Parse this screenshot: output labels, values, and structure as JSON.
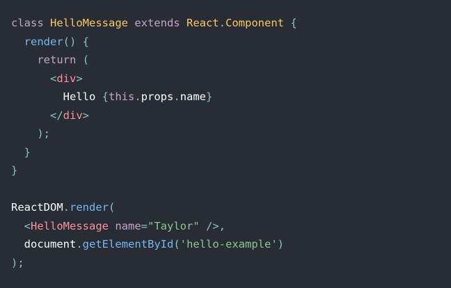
{
  "editor": {
    "language": "jsx",
    "background_color": "#282c34",
    "colors": {
      "keyword": "#c5a5c5",
      "class": "#fac863",
      "tag": "#fc929e",
      "string": "#8dc891",
      "function": "#79b6f2",
      "punctuation": "#88c6be",
      "plain": "#ffffff"
    },
    "lines": [
      [
        {
          "t": "keyword",
          "v": "class "
        },
        {
          "t": "class",
          "v": "HelloMessage"
        },
        {
          "t": "keyword",
          "v": " extends "
        },
        {
          "t": "class",
          "v": "React"
        },
        {
          "t": "punct",
          "v": "."
        },
        {
          "t": "class",
          "v": "Component"
        },
        {
          "t": "punct",
          "v": " {"
        }
      ],
      [
        {
          "t": "plain",
          "v": "  "
        },
        {
          "t": "func",
          "v": "render"
        },
        {
          "t": "punct",
          "v": "() {"
        }
      ],
      [
        {
          "t": "plain",
          "v": "    "
        },
        {
          "t": "keyword",
          "v": "return"
        },
        {
          "t": "punct",
          "v": " ("
        }
      ],
      [
        {
          "t": "plain",
          "v": "      "
        },
        {
          "t": "punct",
          "v": "<"
        },
        {
          "t": "tag",
          "v": "div"
        },
        {
          "t": "punct",
          "v": ">"
        }
      ],
      [
        {
          "t": "plain",
          "v": "        Hello "
        },
        {
          "t": "punct",
          "v": "{"
        },
        {
          "t": "this",
          "v": "this"
        },
        {
          "t": "punct",
          "v": "."
        },
        {
          "t": "prop",
          "v": "props"
        },
        {
          "t": "punct",
          "v": "."
        },
        {
          "t": "prop",
          "v": "name"
        },
        {
          "t": "punct",
          "v": "}"
        }
      ],
      [
        {
          "t": "plain",
          "v": "      "
        },
        {
          "t": "punct",
          "v": "</"
        },
        {
          "t": "tag",
          "v": "div"
        },
        {
          "t": "punct",
          "v": ">"
        }
      ],
      [
        {
          "t": "plain",
          "v": "    "
        },
        {
          "t": "punct",
          "v": ");"
        }
      ],
      [
        {
          "t": "plain",
          "v": "  "
        },
        {
          "t": "punct",
          "v": "}"
        }
      ],
      [
        {
          "t": "punct",
          "v": "}"
        }
      ],
      [],
      [
        {
          "t": "plain",
          "v": "ReactDOM"
        },
        {
          "t": "punct",
          "v": "."
        },
        {
          "t": "func",
          "v": "render"
        },
        {
          "t": "punct",
          "v": "("
        }
      ],
      [
        {
          "t": "plain",
          "v": "  "
        },
        {
          "t": "punct",
          "v": "<"
        },
        {
          "t": "tag",
          "v": "HelloMessage"
        },
        {
          "t": "attr",
          "v": " name"
        },
        {
          "t": "punct",
          "v": "="
        },
        {
          "t": "string",
          "v": "\"Taylor\""
        },
        {
          "t": "punct",
          "v": " />,"
        }
      ],
      [
        {
          "t": "plain",
          "v": "  document"
        },
        {
          "t": "punct",
          "v": "."
        },
        {
          "t": "func",
          "v": "getElementById"
        },
        {
          "t": "punct",
          "v": "("
        },
        {
          "t": "string",
          "v": "'hello-example'"
        },
        {
          "t": "punct",
          "v": ")"
        }
      ],
      [
        {
          "t": "punct",
          "v": ");"
        }
      ]
    ]
  }
}
